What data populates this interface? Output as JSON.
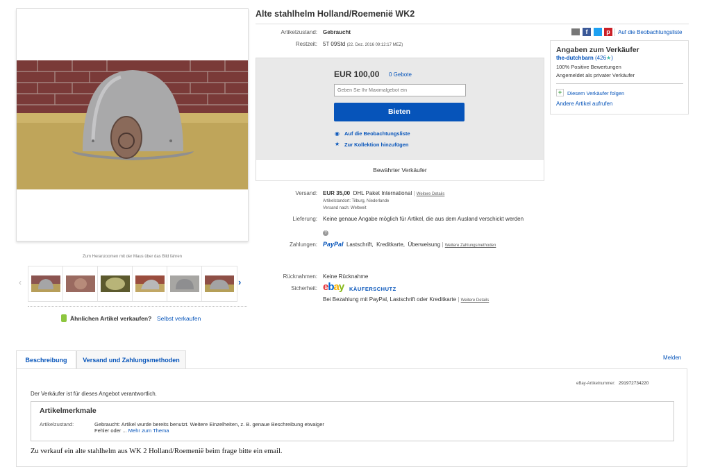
{
  "title": "Alte stahlhelm Holland/Roemenië WK2",
  "condition_label": "Artikelzustand:",
  "condition_value": "Gebraucht",
  "time_label": "Restzeit:",
  "time_value": "5T 09Std",
  "time_detail": "(22. Dez. 2016  09:12:17 MEZ)",
  "watch_top": "Auf die Beobachtungsliste",
  "share_icons": [
    "mail-icon",
    "facebook-icon",
    "twitter-icon",
    "pinterest-icon"
  ],
  "price": "EUR 100,00",
  "bids": "0 Gebote",
  "bid_placeholder": "Geben Sie Ihr Maximalgebot ein",
  "bid_button": "Bieten",
  "watch_link": "Auf die Beobachtungsliste",
  "collection_link": "Zur Kollektion hinzufügen",
  "trusted_seller": "Bewährter Verkäufer",
  "seller": {
    "heading": "Angaben zum Verkäufer",
    "name": "the-dutchbarn",
    "score": "(426",
    "score_end": ")",
    "positive": "100% Positive Bewertungen",
    "private": "Angemeldet als privater Verkäufer",
    "follow": "Diesem Verkäufer folgen",
    "other": "Andere Artikel aufrufen"
  },
  "shipping": {
    "label": "Versand:",
    "price": "EUR 35,00",
    "service": "DHL Paket International",
    "details": "Weitere Details",
    "location": "Artikelstandort: Tilburg, Niederlande",
    "to": "Versand nach: Weltweit"
  },
  "delivery": {
    "label": "Lieferung:",
    "text": "Keine genaue Angabe möglich für Artikel, die aus dem Ausland verschickt werden"
  },
  "payments": {
    "label": "Zahlungen:",
    "paypal": "PayPal",
    "methods": [
      "Lastschrift,",
      "Kreditkarte,",
      "Überweisung"
    ],
    "more": "Weitere Zahlungsmethoden"
  },
  "returns": {
    "label": "Rücknahmen:",
    "value": "Keine Rücknahme"
  },
  "security": {
    "label": "Sicherheit:",
    "logo": "ebay",
    "protection": "KÄUFERSCHUTZ",
    "text": "Bei Bezahlung mit PayPal, Lastschrift oder Kreditkarte",
    "details": "Weitere Details"
  },
  "zoom_hint": "Zum Heranzoomen mit der Maus über das Bild fahren",
  "sell_similar": "Ähnlichen Artikel verkaufen?",
  "sell_yourself": "Selbst verkaufen",
  "tabs": [
    "Beschreibung",
    "Versand und Zahlungsmethoden"
  ],
  "report": "Melden",
  "item_number_label": "eBay-Artikelnummer:",
  "item_number": "291972734220",
  "responsibility": "Der Verkäufer ist für dieses Angebot verantwortlich.",
  "specifics_heading": "Artikelmerkmale",
  "specifics_label": "Artikelzustand:",
  "specifics_value_line1": "Gebraucht: Artikel wurde bereits benutzt. Weitere Einzelheiten, z. B. genaue Beschreibung etwaiger",
  "specifics_value_line2": "Fehler oder ...",
  "specifics_more": "Mehr zum Thema",
  "description": "Zu verkauf ein alte stahlhelm aus WK 2 Holland/Roemenië beim frage bitte ein email."
}
